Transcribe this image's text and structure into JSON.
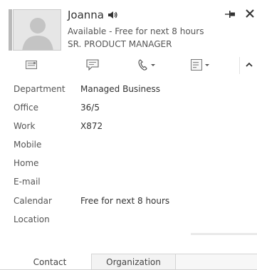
{
  "contact": {
    "name": "Joanna",
    "availability": "Available - Free for next 8 hours",
    "title": "SR. PRODUCT MANAGER"
  },
  "header_icons": {
    "speaker": "speaker-icon",
    "pin": "pin-icon",
    "close": "close-icon"
  },
  "actions": [
    {
      "name": "email",
      "icon": "envelope-icon",
      "has_dropdown": false
    },
    {
      "name": "instant-message",
      "icon": "chat-bubble-icon",
      "has_dropdown": false
    },
    {
      "name": "call",
      "icon": "phone-icon",
      "has_dropdown": true
    },
    {
      "name": "more-options",
      "icon": "list-icon",
      "has_dropdown": true
    }
  ],
  "details": [
    {
      "label": "Department",
      "value": "Managed Business"
    },
    {
      "label": "Office",
      "value": "36/5"
    },
    {
      "label": "Work",
      "value": "X872"
    },
    {
      "label": "Mobile",
      "value": ""
    },
    {
      "label": "Home",
      "value": ""
    },
    {
      "label": "E-mail",
      "value": ""
    },
    {
      "label": "Calendar",
      "value": "Free for next 8 hours"
    },
    {
      "label": "Location",
      "value": ""
    }
  ],
  "tabs": {
    "contact": "Contact",
    "organization": "Organization"
  },
  "colors": {
    "status_unknown": "#b9b9b9",
    "text": "#333333",
    "border": "#d4d4d4"
  }
}
